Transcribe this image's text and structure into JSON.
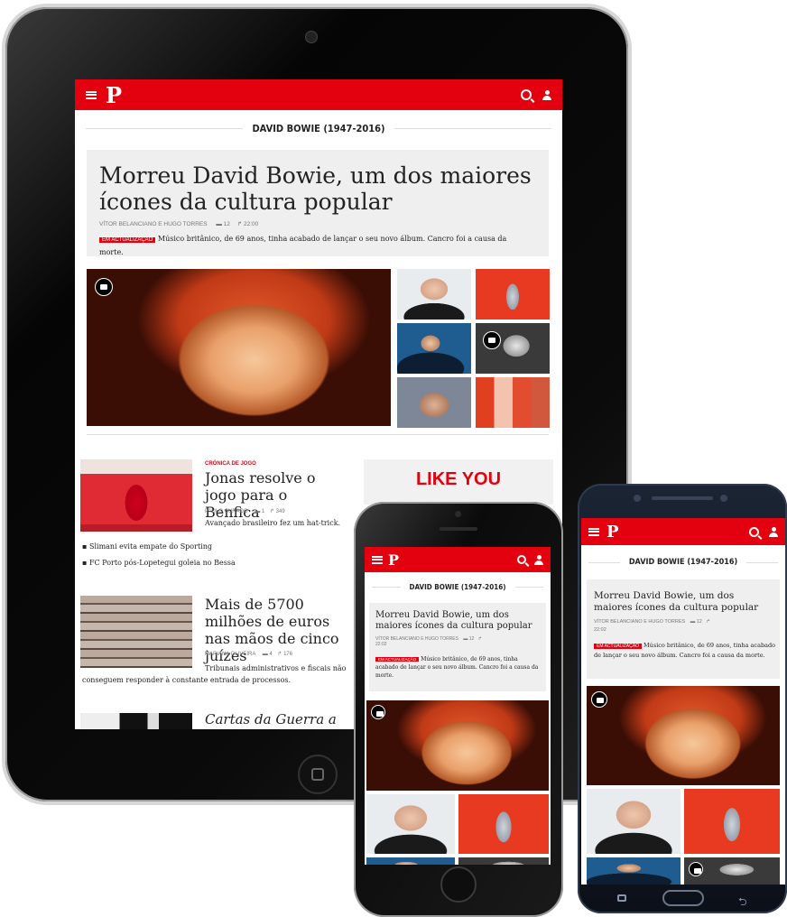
{
  "brand": {
    "logo": "P",
    "accent": "#e3000f"
  },
  "tablet": {
    "kicker": "DAVID BOWIE (1947-2016)",
    "headline": "Morreu David Bowie, um dos maiores ícones da cultura popular",
    "byline": "VÍTOR BELANCIANO e HUGO TORRES",
    "comments": "12",
    "shares": "22:00",
    "badge": "EM ACTUALIZAÇÃO",
    "lead": "Músico britânico, de 69 anos, tinha acabado de lançar o seu novo álbum. Cancro foi a causa da morte.",
    "stories": [
      {
        "kicker": "CRÓNICA DE JOGO",
        "title": "Jonas resolve o jogo para o Benfica",
        "byline": "PAULO CURADO",
        "comments": "1",
        "shares": "349",
        "dek": "Avançado brasileiro fez um hat-trick."
      },
      {
        "title": "Mais de 5700 milhões de euros nas mãos de cinco juízes",
        "byline": "MARIANA OLIVEIRA",
        "comments": "4",
        "shares": "176",
        "dek": "Tribunais administrativos e fiscais não conseguem responder à constante entrada de processos."
      },
      {
        "title": "Cartas da Guerra a"
      }
    ],
    "bullets": [
      "Slimani evita empate do Sporting",
      "FC Porto pós-Lopetegui goleia no Bessa"
    ],
    "ad_text": "LIKE YOU"
  },
  "iphone": {
    "kicker": "DAVID BOWIE (1947-2016)",
    "headline": "Morreu David Bowie, um dos maiores ícones da cultura popular",
    "byline": "VÍTOR BELANCIANO e HUGO TORRES",
    "comments": "12",
    "time": "22:02",
    "badge": "EM ACTUALIZAÇÃO",
    "lead": "Músico britânico, de 69 anos, tinha acabado de lançar o seu novo álbum. Cancro foi a causa da morte."
  },
  "samsung": {
    "kicker": "DAVID BOWIE (1947-2016)",
    "headline": "Morreu David Bowie, um dos maiores ícones da cultura popular",
    "byline": "VÍTOR BELANCIANO e HUGO TORRES",
    "comments": "12",
    "time": "22:02",
    "badge": "EM ACTUALIZAÇÃO",
    "lead": "Músico britânico, de 69 anos, tinha acabado de lançar o seu novo álbum. Cancro foi a causa da morte."
  }
}
